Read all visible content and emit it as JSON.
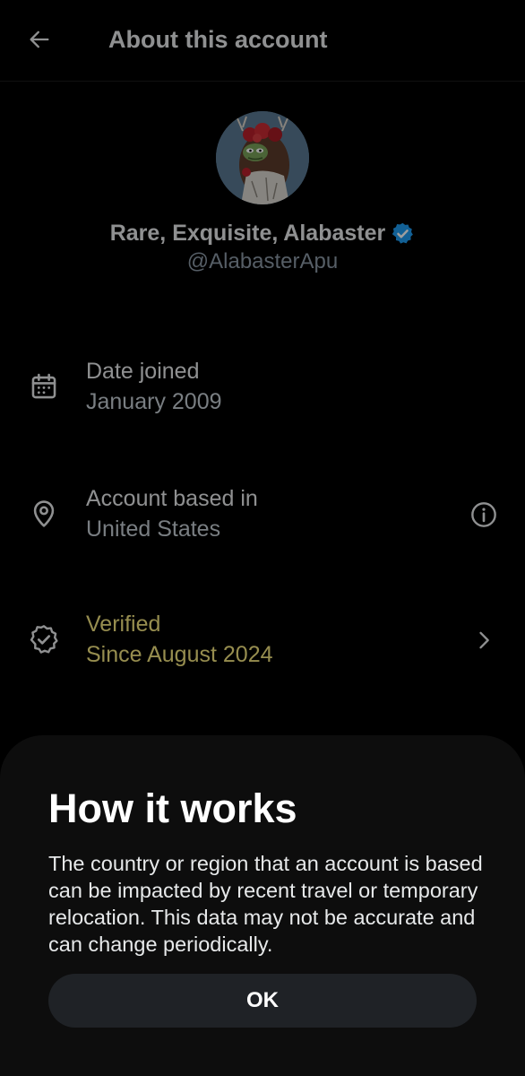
{
  "header": {
    "title": "About this account",
    "back_icon": "arrow-left-icon"
  },
  "profile": {
    "display_name": "Rare, Exquisite, Alabaster",
    "handle": "@AlabasterApu",
    "verified_badge_color": "#1d9bf0"
  },
  "info_rows": {
    "date_joined": {
      "label": "Date joined",
      "value": "January 2009",
      "icon": "calendar-icon"
    },
    "based_in": {
      "label": "Account based in",
      "value": "United States",
      "icon": "location-pin-icon",
      "trailing_icon": "info-circle-icon"
    },
    "verified": {
      "label": "Verified",
      "value": "Since August 2024",
      "icon": "verified-badge-outline-icon",
      "trailing_icon": "chevron-right-icon",
      "color": "#f2e480"
    }
  },
  "sheet": {
    "title": "How it works",
    "body": "The country or region that an account is based can be impacted by recent travel or temporary relocation. This data may not be accurate and can change periodically.",
    "ok_label": "OK"
  },
  "colors": {
    "background": "#000000",
    "sheet_background": "#0d0d0d",
    "button_background": "#1f2226",
    "secondary_text": "#8b98a5"
  }
}
